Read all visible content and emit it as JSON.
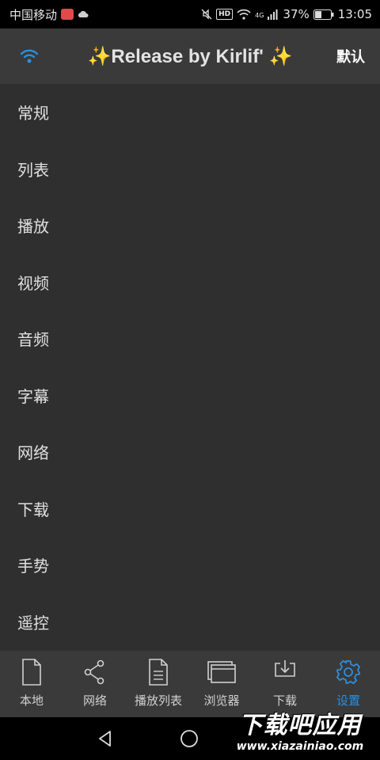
{
  "status_bar": {
    "carrier": "中国移动",
    "hd": "HD",
    "network": "4G",
    "battery": "37%",
    "time": "13:05"
  },
  "header": {
    "title": "✨Release by Kirlif' ✨",
    "default_label": "默认",
    "wifi_icon": "wifi-icon",
    "accent": "#2a8fe0"
  },
  "settings": {
    "items": [
      {
        "label": "常规"
      },
      {
        "label": "列表"
      },
      {
        "label": "播放"
      },
      {
        "label": "视频"
      },
      {
        "label": "音频"
      },
      {
        "label": "字幕"
      },
      {
        "label": "网络"
      },
      {
        "label": "下载"
      },
      {
        "label": "手势"
      },
      {
        "label": "遥控"
      }
    ]
  },
  "bottom_nav": {
    "items": [
      {
        "label": "本地",
        "icon": "file-icon"
      },
      {
        "label": "网络",
        "icon": "share-icon"
      },
      {
        "label": "播放列表",
        "icon": "document-icon"
      },
      {
        "label": "浏览器",
        "icon": "windows-icon"
      },
      {
        "label": "下载",
        "icon": "download-icon"
      },
      {
        "label": "设置",
        "icon": "gear-icon",
        "active": true
      }
    ]
  },
  "watermark": {
    "title": "下载吧应用",
    "url": "www.xiazainiao.com"
  }
}
